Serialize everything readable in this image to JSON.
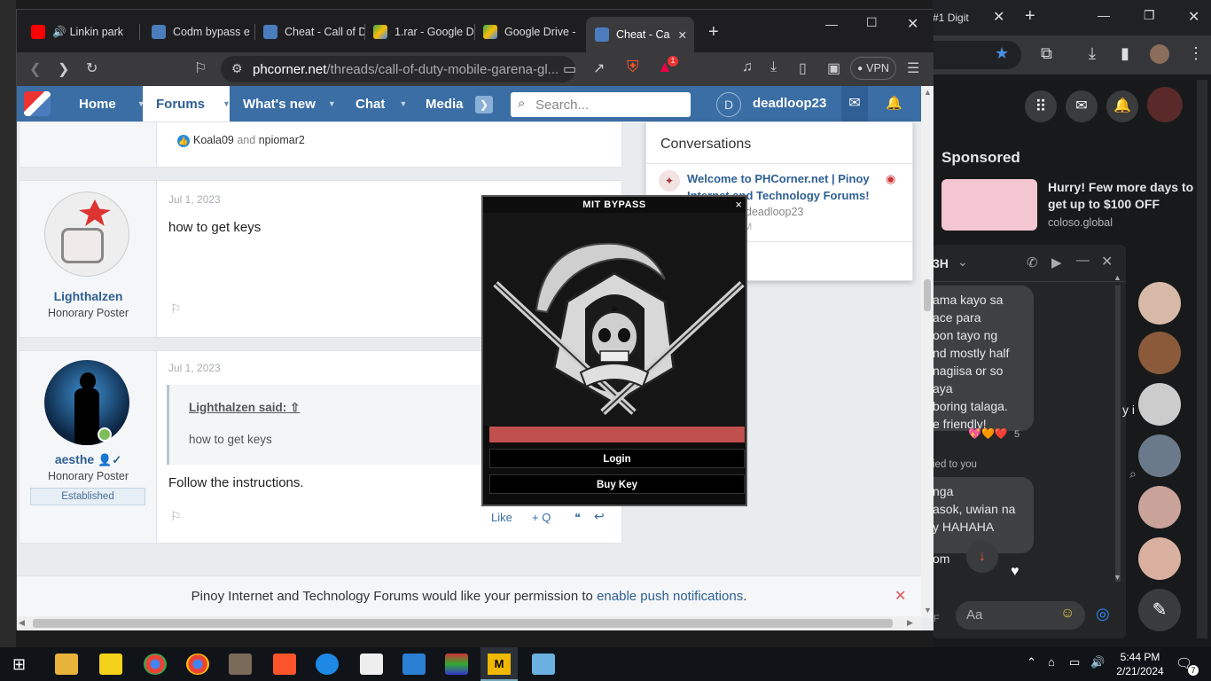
{
  "brave": {
    "tabs": [
      {
        "label": "Linkin park"
      },
      {
        "label": "Codm bypass e"
      },
      {
        "label": "Cheat - Call of D"
      },
      {
        "label": "1.rar - Google D"
      },
      {
        "label": "Google Drive -"
      },
      {
        "label": "Cheat - Ca"
      }
    ],
    "new_tab": "+",
    "url_host": "phcorner.net",
    "url_path": "/threads/call-of-duty-mobile-garena-gl...",
    "vpn_label": "VPN",
    "notif_count": "1"
  },
  "nav": {
    "items": [
      {
        "label": "Home"
      },
      {
        "label": "Forums"
      },
      {
        "label": "What's new"
      },
      {
        "label": "Chat"
      },
      {
        "label": "Media"
      }
    ],
    "search_placeholder": "Search...",
    "avatar_letter": "D",
    "username": "deadloop23"
  },
  "posts": {
    "reactions": "Koala09",
    "reactions_and": "and",
    "reactions_second": "npiomar2",
    "post1": {
      "date": "Jul 1, 2023",
      "body": "how to get keys",
      "user": "Lighthalzen",
      "user_title": "Honorary Poster"
    },
    "post2": {
      "date": "Jul 1, 2023",
      "quote_author": "Lighthalzen said:",
      "quote_text": "how to get keys",
      "body": "Follow the instructions.",
      "user": "aesthe",
      "user_title": "Honorary Poster",
      "badge": "Established",
      "like": "Like",
      "quote_btn": "+ Q"
    }
  },
  "conversations": {
    "title": "Conversations",
    "item_title_1": "Welcome to PHCorner.net | Pinoy",
    "item_title_2": "Internet and Technology Forums!",
    "item_meta": "deadloop23",
    "item_time": "M"
  },
  "push": {
    "text": "Pinoy Internet and Technology Forums would like your permission to",
    "link": "enable push notifications",
    "period": "."
  },
  "popup": {
    "title": "MIT BYPASS",
    "close": "×",
    "login": "Login",
    "buy_key": "Buy Key",
    "input_color": "#c0504d"
  },
  "right": {
    "tab_title": "e #1 Digit",
    "sponsored": "Sponsored",
    "ad_title": "Hurry! Few more days to get up to $100 OFF",
    "ad_domain": "coloso.global",
    "chat_name": "3H",
    "msg_lines": [
      "ama kayo  sa",
      "ace para",
      "oon tayo ng",
      "nd mostly half",
      "nagiisa or so",
      "aya",
      "boring talaga.",
      "e friendly!"
    ],
    "reaction_count": "5",
    "replied": "ied to you",
    "msg2_lines": [
      "nga",
      "asok, uwian na",
      "y HAHAHA"
    ],
    "msg3": "om",
    "side_text": "y i",
    "composer_placeholder": "Aa"
  },
  "taskbar": {
    "time": "5:44 PM",
    "date": "2/21/2024",
    "notif": "7"
  }
}
